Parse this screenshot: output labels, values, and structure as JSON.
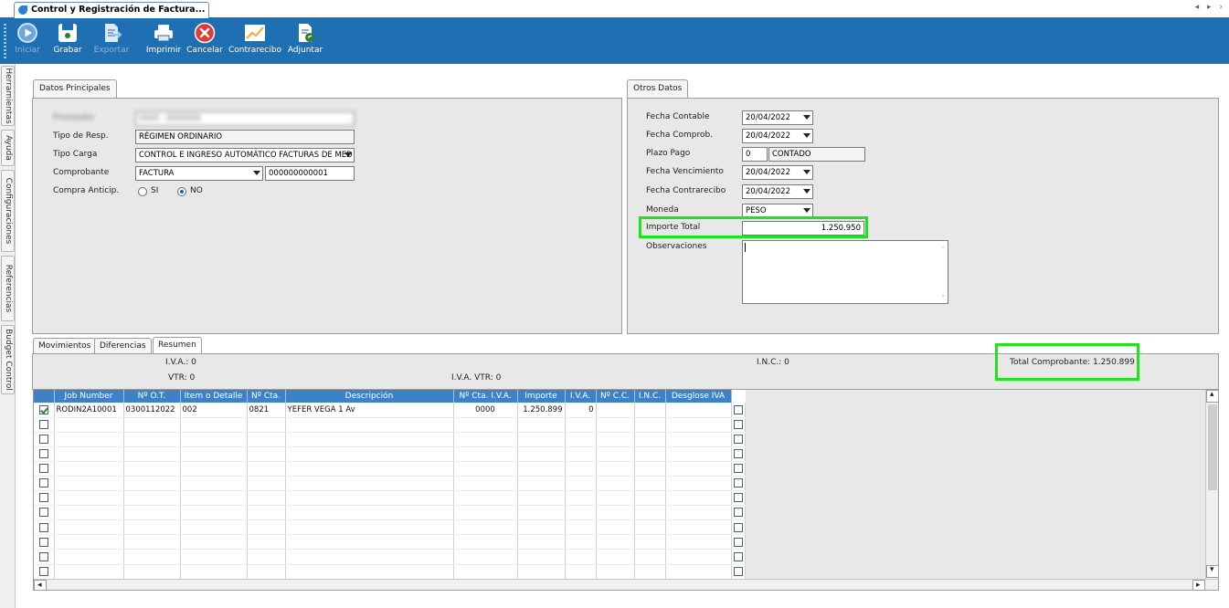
{
  "tab": {
    "title": "Control y Registración de Factura..."
  },
  "toolbar": {
    "buttons": [
      {
        "id": "iniciar",
        "label": "Iniciar",
        "icon": "play-icon",
        "enabled": false
      },
      {
        "id": "grabar",
        "label": "Grabar",
        "icon": "save-icon",
        "enabled": true
      },
      {
        "id": "exportar",
        "label": "Exportar",
        "icon": "export-icon",
        "enabled": false
      },
      {
        "id": "imprimir",
        "label": "Imprimir",
        "icon": "printer-icon",
        "enabled": true
      },
      {
        "id": "cancelar",
        "label": "Cancelar",
        "icon": "cancel-icon",
        "enabled": true
      },
      {
        "id": "contrarecibo",
        "label": "Contrarecibo",
        "icon": "chart-icon",
        "enabled": true
      },
      {
        "id": "adjuntar",
        "label": "Adjuntar",
        "icon": "attach-icon",
        "enabled": true
      }
    ]
  },
  "sidebar": {
    "tabs": [
      "Herramientas",
      "Ayuda",
      "Configuraciones",
      "Referencias",
      "Budget Control"
    ]
  },
  "datos_principales": {
    "tab_label": "Datos Principales",
    "proveedor": {
      "label": "Proveedor",
      "value": "0000 - 0000000"
    },
    "tipo_resp": {
      "label": "Tipo de Resp.",
      "value": "RÉGIMEN ORDINARIO"
    },
    "tipo_carga": {
      "label": "Tipo Carga",
      "value": "CONTROL E INGRESO AUTOMÁTICO FACTURAS DE MED"
    },
    "comprobante": {
      "label": "Comprobante",
      "value": "FACTURA",
      "number": "000000000001"
    },
    "compra_anticip": {
      "label": "Compra Anticip.",
      "options": [
        "SI",
        "NO"
      ],
      "selected": "NO"
    }
  },
  "otros_datos": {
    "tab_label": "Otros Datos",
    "fecha_contable": {
      "label": "Fecha Contable",
      "value": "20/04/2022"
    },
    "fecha_comprob": {
      "label": "Fecha Comprob.",
      "value": "20/04/2022"
    },
    "plazo_pago": {
      "label": "Plazo Pago",
      "days": "0",
      "value": "CONTADO"
    },
    "fecha_vencimiento": {
      "label": "Fecha Vencimiento",
      "value": "20/04/2022"
    },
    "fecha_contrarecibo": {
      "label": "Fecha Contrarecibo",
      "value": "20/04/2022"
    },
    "moneda": {
      "label": "Moneda",
      "value": "PESO"
    },
    "importe_total": {
      "label": "Importe Total",
      "value": "1.250.950"
    },
    "observaciones": {
      "label": "Observaciones",
      "value": ""
    }
  },
  "bottom_tabs": [
    "Movimientos",
    "Diferencias",
    "Resumen"
  ],
  "active_bottom_tab": "Resumen",
  "resumen": {
    "iva": "I.V.A.: 0",
    "inc": "I.N.C.: 0",
    "total_comprobante": "Total Comprobante: 1.250.899",
    "vtr": "VTR: 0",
    "iva_vtr": "I.V.A. VTR: 0"
  },
  "grid": {
    "columns": [
      "",
      "Job Number",
      "Nº O.T.",
      "Item o Detalle",
      "Nº Cta.",
      "Descripción",
      "Nº Cta. I.V.A.",
      "Importe",
      "I.V.A.",
      "Nº C.C.",
      "I.N.C.",
      "Desglose IVA"
    ],
    "rows": [
      {
        "checked": true,
        "cells": [
          "RODIN2A10001",
          "0300112022",
          "002",
          "0821",
          "YEFER VEGA 1 Av",
          "0000",
          "1.250.899",
          "0",
          "",
          "",
          ""
        ],
        "desglose": false
      },
      {
        "checked": false,
        "cells": [
          "",
          "",
          "",
          "",
          "",
          "",
          "",
          "",
          "",
          "",
          ""
        ],
        "desglose": false
      },
      {
        "checked": false,
        "cells": [
          "",
          "",
          "",
          "",
          "",
          "",
          "",
          "",
          "",
          "",
          ""
        ],
        "desglose": false
      },
      {
        "checked": false,
        "cells": [
          "",
          "",
          "",
          "",
          "",
          "",
          "",
          "",
          "",
          "",
          ""
        ],
        "desglose": false
      },
      {
        "checked": false,
        "cells": [
          "",
          "",
          "",
          "",
          "",
          "",
          "",
          "",
          "",
          "",
          ""
        ],
        "desglose": false
      },
      {
        "checked": false,
        "cells": [
          "",
          "",
          "",
          "",
          "",
          "",
          "",
          "",
          "",
          "",
          ""
        ],
        "desglose": false
      },
      {
        "checked": false,
        "cells": [
          "",
          "",
          "",
          "",
          "",
          "",
          "",
          "",
          "",
          "",
          ""
        ],
        "desglose": false
      },
      {
        "checked": false,
        "cells": [
          "",
          "",
          "",
          "",
          "",
          "",
          "",
          "",
          "",
          "",
          ""
        ],
        "desglose": false
      },
      {
        "checked": false,
        "cells": [
          "",
          "",
          "",
          "",
          "",
          "",
          "",
          "",
          "",
          "",
          ""
        ],
        "desglose": false
      },
      {
        "checked": false,
        "cells": [
          "",
          "",
          "",
          "",
          "",
          "",
          "",
          "",
          "",
          "",
          ""
        ],
        "desglose": false
      },
      {
        "checked": false,
        "cells": [
          "",
          "",
          "",
          "",
          "",
          "",
          "",
          "",
          "",
          "",
          ""
        ],
        "desglose": false
      },
      {
        "checked": false,
        "cells": [
          "",
          "",
          "",
          "",
          "",
          "",
          "",
          "",
          "",
          "",
          ""
        ],
        "desglose": false
      }
    ]
  },
  "colors": {
    "toolbar": "#1f6fb3",
    "grid_header": "#3d82c4",
    "highlight": "#1de51d"
  }
}
